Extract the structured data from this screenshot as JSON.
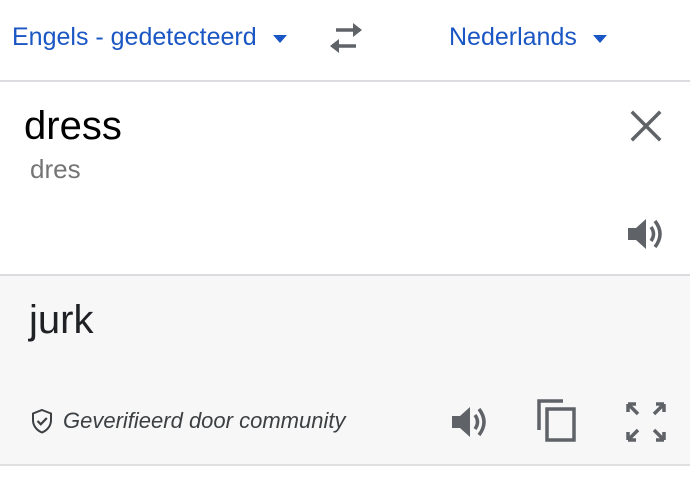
{
  "languages": {
    "source_label": "Engels - gedetecteerd",
    "target_label": "Nederlands"
  },
  "source": {
    "text": "dress",
    "transliteration": "dres"
  },
  "result": {
    "text": "jurk",
    "verified_label": "Geverifieerd door community"
  },
  "icons": {
    "swap": "swap-arrows-icon",
    "clear": "close-icon",
    "speak": "speaker-icon",
    "copy": "copy-icon",
    "fullscreen": "fullscreen-icon",
    "verified": "shield-check-icon"
  },
  "colors": {
    "accent": "#1a56c4",
    "icon": "#5f6368",
    "result_bg": "#f7f7f7"
  }
}
